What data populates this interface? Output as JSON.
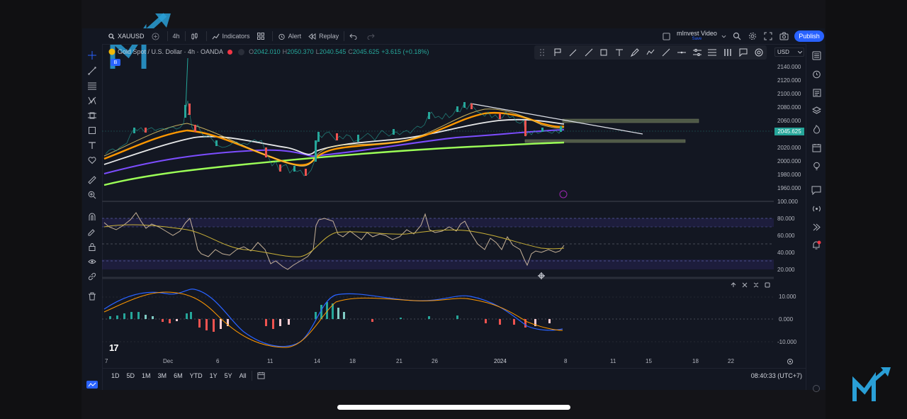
{
  "topbar": {
    "symbol": "XAUUSD",
    "interval": "4h",
    "indicators_label": "Indicators",
    "alert_label": "Alert",
    "replay_label": "Replay",
    "layout_name": "mInvest Video",
    "layout_sub": "Save",
    "publish_label": "Publish"
  },
  "legend": {
    "title": "Gold Spot / U.S. Dollar · 4h · OANDA",
    "o_label": "O",
    "o_value": "2042.010",
    "h_label": "H",
    "h_value": "2050.370",
    "l_label": "L",
    "l_value": "2040.545",
    "change": "+3.615 (+0.18%)",
    "badge": "B"
  },
  "price_axis": {
    "currency": "USD",
    "last_price": "2045.625",
    "ticks": [
      "2140.000",
      "2120.000",
      "2100.000",
      "2080.000",
      "2060.000",
      "2040.000",
      "2020.000",
      "2000.000",
      "1980.000",
      "1960.000"
    ]
  },
  "rsi_axis": {
    "ticks": [
      "100.000",
      "80.000",
      "60.000",
      "40.000",
      "20.000"
    ]
  },
  "macd_axis": {
    "ticks": [
      "10.000",
      "0.000",
      "-10.000"
    ]
  },
  "time_axis": {
    "ticks": [
      "7",
      "Dec",
      "6",
      "11",
      "14",
      "18",
      "21",
      "26",
      "2024",
      "8",
      "11",
      "15",
      "18",
      "22"
    ]
  },
  "bottombar": {
    "ranges": [
      "1D",
      "5D",
      "1M",
      "3M",
      "6M",
      "YTD",
      "1Y",
      "5Y",
      "All"
    ],
    "clock": "08:40:33 (UTC+7)"
  },
  "chart_data": {
    "type": "candlestick",
    "symbol": "XAUUSD",
    "interval": "4h",
    "price_ylim": [
      1950,
      2150
    ],
    "approx_close_path": [
      2005,
      2015,
      2030,
      2040,
      2045,
      2050,
      2070,
      2040,
      2035,
      2025,
      2030,
      2030,
      2025,
      2015,
      2000,
      1985,
      1980,
      1990,
      2040,
      2045,
      2035,
      2040,
      2040,
      2045,
      2050,
      2050,
      2055,
      2060,
      2065,
      2070,
      2075,
      2085,
      2075,
      2065,
      2055,
      2040,
      2035,
      2040,
      2045
    ],
    "rsi": {
      "ylim": [
        20,
        100
      ],
      "levels": [
        80,
        70,
        50,
        30
      ]
    },
    "macd": {
      "ylim": [
        -12,
        12
      ],
      "zero": 0
    },
    "colors": {
      "up": "#26a69a",
      "down": "#ef5350",
      "ema_fast": "#ff9800",
      "ema_mid": "#ffffff",
      "ema_slow": "#7c4dff",
      "ema_long": "#9cff57"
    }
  },
  "colors": {
    "accent": "#2962ff",
    "background": "#131722",
    "up": "#26a69a",
    "down": "#ef5350"
  }
}
